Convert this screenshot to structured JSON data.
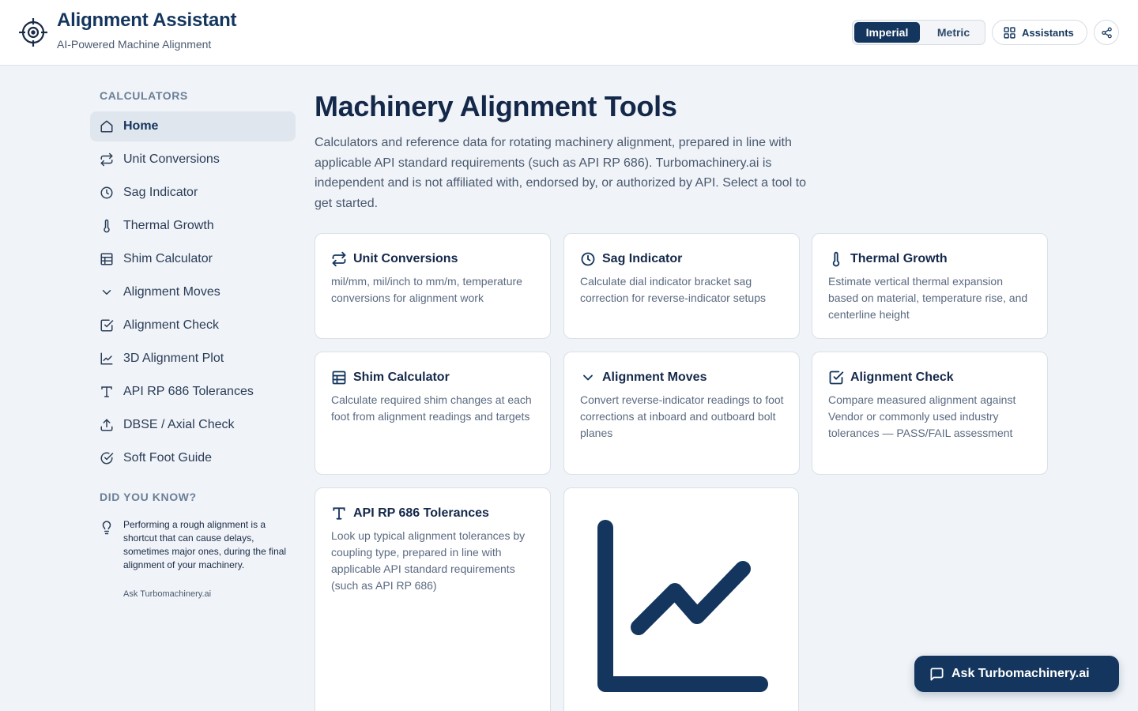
{
  "header": {
    "title": "Alignment Assistant",
    "subtitle": "AI-Powered Machine Alignment",
    "logo_icon": "crosshair-icon",
    "units": {
      "imperial": "Imperial",
      "metric": "Metric",
      "selected": "Imperial"
    },
    "assistants_label": "Assistants",
    "share_icon": "share-icon"
  },
  "sidebar": {
    "calculators_heading": "CALCULATORS",
    "items": [
      {
        "label": "Home",
        "icon": "home-icon",
        "active": true
      },
      {
        "label": "Unit Conversions",
        "icon": "repeat-icon"
      },
      {
        "label": "Sag Indicator",
        "icon": "clock-icon"
      },
      {
        "label": "Thermal Growth",
        "icon": "thermometer-icon"
      },
      {
        "label": "Shim Calculator",
        "icon": "table-icon"
      },
      {
        "label": "Alignment Moves",
        "icon": "chevron-down-icon"
      },
      {
        "label": "Alignment Check",
        "icon": "check-square-icon"
      },
      {
        "label": "3D Alignment Plot",
        "icon": "line-chart-icon"
      },
      {
        "label": "API RP 686 Tolerances",
        "icon": "type-icon"
      },
      {
        "label": "DBSE / Axial Check",
        "icon": "upload-icon"
      },
      {
        "label": "Soft Foot Guide",
        "icon": "check-circle-icon"
      }
    ],
    "did_you_know_heading": "DID YOU KNOW?",
    "tip": {
      "text": "Performing a rough alignment is a shortcut that can cause delays, sometimes major ones, during the final alignment of your machinery.",
      "source": "Ask Turbomachinery.ai",
      "icon": "lightbulb-icon"
    }
  },
  "main": {
    "title": "Machinery Alignment Tools",
    "description": "Calculators and reference data for rotating machinery alignment, prepared in line with applicable API standard requirements (such as API RP 686). Turbomachinery.ai is independent and is not affiliated with, endorsed by, or authorized by API. Select a tool to get started.",
    "cards": [
      {
        "title": "Unit Conversions",
        "icon": "repeat-icon",
        "description": "mil/mm, mil/inch to mm/m, temperature conversions for alignment work"
      },
      {
        "title": "Sag Indicator",
        "icon": "clock-icon",
        "description": "Calculate dial indicator bracket sag correction for reverse-indicator setups"
      },
      {
        "title": "Thermal Growth",
        "icon": "thermometer-icon",
        "description": "Estimate vertical thermal expansion based on material, temperature rise, and centerline height"
      },
      {
        "title": "Shim Calculator",
        "icon": "table-icon",
        "description": "Calculate required shim changes at each foot from alignment readings and targets"
      },
      {
        "title": "Alignment Moves",
        "icon": "chevron-down-icon",
        "description": "Convert reverse-indicator readings to foot corrections at inboard and outboard bolt planes"
      },
      {
        "title": "Alignment Check",
        "icon": "check-square-icon",
        "description": "Compare measured alignment against Vendor or commonly used industry tolerances — PASS/FAIL assessment"
      },
      {
        "title": "API RP 686 Tolerances",
        "icon": "type-icon",
        "description": "Look up typical alignment tolerances by coupling type, prepared in line with applicable API standard requirements (such as API RP 686)"
      }
    ],
    "chart_card_icon": "line-chart-icon"
  },
  "chat_button": {
    "label": "Ask Turbomachinery.ai",
    "icon": "message-square-icon"
  },
  "colors": {
    "primary": "#14365e",
    "background": "#f0f3f7",
    "card": "#ffffff",
    "muted_text": "#5a6a80"
  }
}
